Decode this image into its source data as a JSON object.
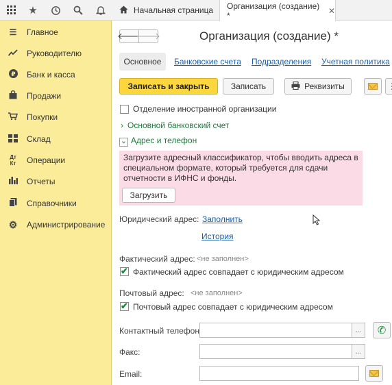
{
  "top_tabs": {
    "home": "Начальная страница",
    "current": "Организация (создание) *"
  },
  "sidebar": {
    "items": [
      {
        "label": "Главное",
        "icon": "menu-icon"
      },
      {
        "label": "Руководителю",
        "icon": "chart-line-icon"
      },
      {
        "label": "Банк и касса",
        "icon": "ruble-icon"
      },
      {
        "label": "Продажи",
        "icon": "shopping-bag-icon"
      },
      {
        "label": "Покупки",
        "icon": "cart-icon"
      },
      {
        "label": "Склад",
        "icon": "warehouse-icon"
      },
      {
        "label": "Операции",
        "icon": "operations-icon"
      },
      {
        "label": "Отчеты",
        "icon": "bar-chart-icon"
      },
      {
        "label": "Справочники",
        "icon": "books-icon"
      },
      {
        "label": "Администрирование",
        "icon": "gear-icon"
      }
    ]
  },
  "form": {
    "title": "Организация (создание) *",
    "tabs": {
      "main": "Основное",
      "bank": "Банковские счета",
      "divisions": "Подразделения",
      "accounting": "Учетная политика"
    },
    "toolbar": {
      "save_close": "Записать и закрыть",
      "save": "Записать",
      "requisites": "Реквизиты",
      "more": "⋮"
    },
    "foreign_branch": {
      "label": "Отделение иностранной организации",
      "checked": false
    },
    "bank_account_group": "Основной банковский счет",
    "address_group": "Адрес и телефон",
    "notice": {
      "text": "Загрузите адресный классификатор, чтобы вводить адреса в специальном формате, который требуется для сдачи отчетности в ИФНС и фонды.",
      "button": "Загрузить"
    },
    "legal_address": {
      "label": "Юридический адрес:",
      "fill_link": "Заполнить",
      "history_link": "История"
    },
    "actual_address": {
      "label": "Фактический адрес:",
      "value": "<не заполнен>",
      "same_label": "Фактический адрес совпадает с юридическим адресом",
      "same_checked": true
    },
    "postal_address": {
      "label": "Почтовый адрес:",
      "value": "<не заполнен>",
      "same_label": "Почтовый адрес совпадает с юридическим адресом",
      "same_checked": true
    },
    "phone": {
      "label": "Контактный телефон:",
      "value": "",
      "button": "..."
    },
    "fax": {
      "label": "Факс:",
      "value": "",
      "button": "..."
    },
    "email": {
      "label": "Email:",
      "value": ""
    }
  },
  "colors": {
    "sidebar_bg": "#fbec9a",
    "primary_button": "#fbd63f",
    "notice_bg": "#fadbe6",
    "link": "#1a5fa8",
    "group_link": "#1b7c3a"
  }
}
